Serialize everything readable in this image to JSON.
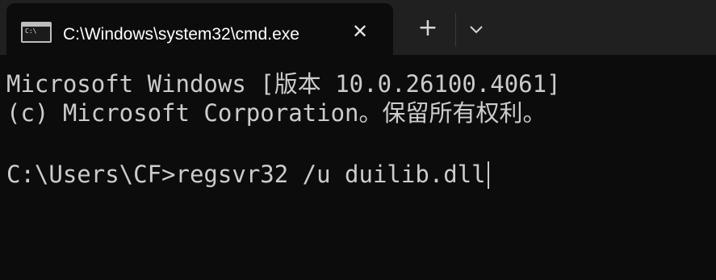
{
  "tab": {
    "title": "C:\\Windows\\system32\\cmd.exe",
    "icon": "cmd-icon",
    "icon_glyph": "C:\\",
    "close_glyph": "✕"
  },
  "toolbar": {
    "new_tab_glyph": "+",
    "dropdown_icon": "chevron-down-icon"
  },
  "console": {
    "lines": [
      "Microsoft Windows [版本 10.0.26100.4061]",
      "(c) Microsoft Corporation。保留所有权利。",
      "",
      "C:\\Users\\CF>regsvr32 /u duilib.dll"
    ],
    "prompt": "C:\\Users\\CF>",
    "command": "regsvr32 /u duilib.dll"
  },
  "colors": {
    "background": "#0c0c0c",
    "tabstrip": "#202020",
    "text": "#cccccc"
  }
}
